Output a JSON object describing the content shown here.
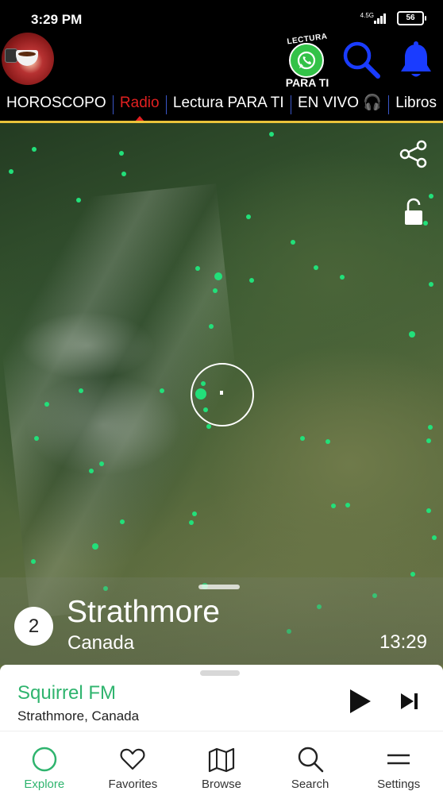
{
  "status": {
    "time": "3:29 PM",
    "network": "4.5G",
    "battery": "56"
  },
  "header": {
    "promo_top": "LECTURA",
    "promo_bottom": "PARA TI"
  },
  "tabs": [
    {
      "label": "HOROSCOPO",
      "active": false
    },
    {
      "label": "Radio",
      "active": true
    },
    {
      "label": "Lectura PARA TI",
      "active": false
    },
    {
      "label": "EN VIVO 🎧",
      "active": false
    },
    {
      "label": "Libros",
      "active": false
    }
  ],
  "location": {
    "rank": "2",
    "city": "Strathmore",
    "country": "Canada",
    "local_time": "13:29"
  },
  "player": {
    "station": "Squirrel FM",
    "location": "Strathmore, Canada"
  },
  "nav": {
    "explore": "Explore",
    "favorites": "Favorites",
    "browse": "Browse",
    "search": "Search",
    "settings": "Settings"
  },
  "colors": {
    "accent_green": "#2fb46e",
    "dot_green": "#22e07a",
    "tab_active": "#e02020",
    "tab_separator": "#3a56c8",
    "header_icon_blue": "#1a3cff",
    "gold_line": "#e9c23a"
  }
}
